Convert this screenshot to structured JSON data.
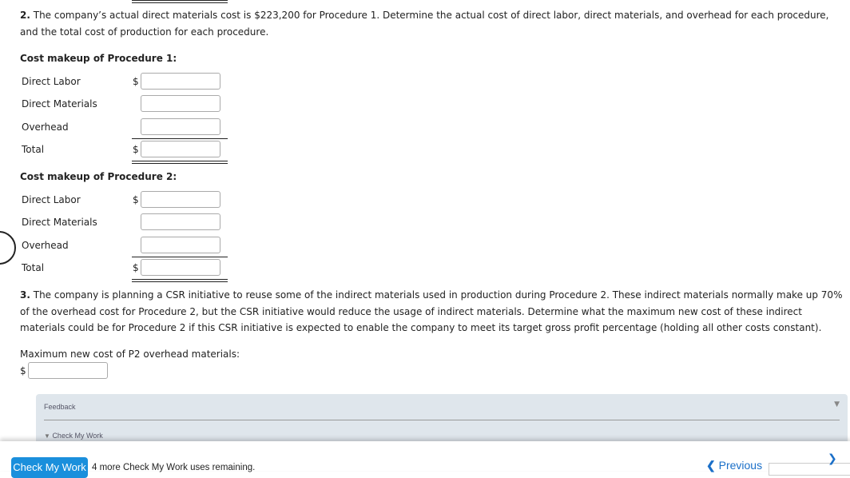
{
  "q2": {
    "number": "2.",
    "text": " The company’s actual direct materials cost is $223,200 for Procedure 1. Determine the actual cost of direct labor, direct materials, and overhead for each procedure, and the total cost of production for each procedure.",
    "proc1": {
      "heading": "Cost makeup of Procedure 1:",
      "rows": [
        {
          "label": "Direct Labor",
          "currency": "$",
          "value": ""
        },
        {
          "label": "Direct Materials",
          "currency": "",
          "value": ""
        },
        {
          "label": "Overhead",
          "currency": "",
          "value": ""
        },
        {
          "label": "Total",
          "currency": "$",
          "value": ""
        }
      ]
    },
    "proc2": {
      "heading": "Cost makeup of Procedure 2:",
      "rows": [
        {
          "label": "Direct Labor",
          "currency": "$",
          "value": ""
        },
        {
          "label": "Direct Materials",
          "currency": "",
          "value": ""
        },
        {
          "label": "Overhead",
          "currency": "",
          "value": ""
        },
        {
          "label": "Total",
          "currency": "$",
          "value": ""
        }
      ]
    }
  },
  "q3": {
    "number": "3.",
    "text": " The company is planning a CSR initiative to reuse some of the indirect materials used in production during Procedure 2. These indirect materials normally make up 70% of the overhead cost for Procedure 2, but the CSR initiative would reduce the usage of indirect materials. Determine what the maximum new cost of these indirect materials could be for Procedure 2 if this CSR initiative is expected to enable the company to meet its target gross profit percentage (holding all other costs constant).",
    "label": "Maximum new cost of P2 overhead materials:",
    "currency": "$",
    "value": ""
  },
  "feedback": {
    "title": "Feedback",
    "toggle": "Check My Work",
    "arrow": "▼"
  },
  "footer": {
    "check_button": "Check My Work",
    "remaining": "4 more Check My Work uses remaining.",
    "previous": "Previous",
    "accent": "#1a8fdc"
  }
}
